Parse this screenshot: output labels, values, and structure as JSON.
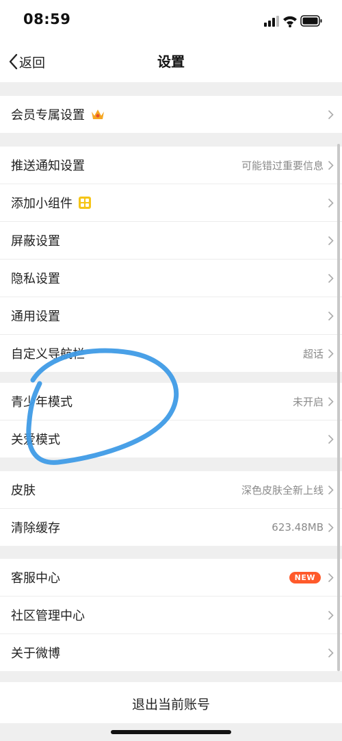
{
  "status_bar": {
    "time": "08:59"
  },
  "nav": {
    "back_label": "返回",
    "title": "设置"
  },
  "group1": [
    {
      "label": "会员专属设置",
      "value": "",
      "icon": "crown-icon"
    }
  ],
  "group2": [
    {
      "label": "推送通知设置",
      "value": "可能错过重要信息"
    },
    {
      "label": "添加小组件",
      "value": "",
      "icon": "widget-grid-icon"
    },
    {
      "label": "屏蔽设置",
      "value": ""
    },
    {
      "label": "隐私设置",
      "value": ""
    },
    {
      "label": "通用设置",
      "value": ""
    },
    {
      "label": "自定义导航栏",
      "value": "超话"
    }
  ],
  "group3": [
    {
      "label": "青少年模式",
      "value": "未开启"
    },
    {
      "label": "关爱模式",
      "value": ""
    }
  ],
  "group4": [
    {
      "label": "皮肤",
      "value": "深色皮肤全新上线"
    },
    {
      "label": "清除缓存",
      "value": "623.48MB"
    }
  ],
  "group5": [
    {
      "label": "客服中心",
      "badge": "NEW"
    },
    {
      "label": "社区管理中心",
      "value": ""
    },
    {
      "label": "关于微博",
      "value": ""
    }
  ],
  "logout_label": "退出当前账号",
  "colors": {
    "background": "#efefef",
    "badge": "#ff5a2b",
    "crown": "#f5a623",
    "widget": "#f5c518",
    "annotation_circle": "#3f9be6"
  }
}
